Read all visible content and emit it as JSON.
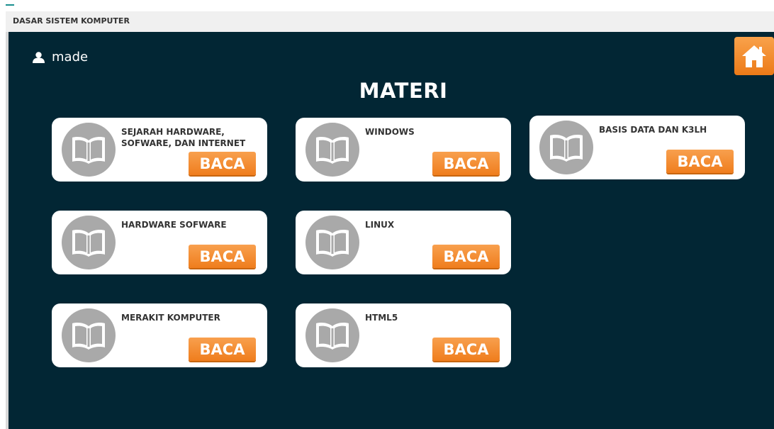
{
  "window": {
    "title": "DASAR SISTEM KOMPUTER"
  },
  "user": {
    "name": "made",
    "icon": "user-icon"
  },
  "home": {
    "icon": "home-icon"
  },
  "page": {
    "title": "MATERI"
  },
  "materials": [
    {
      "title": "SEJARAH HARDWARE, SOFWARE, DAN INTERNET",
      "button": "BACA"
    },
    {
      "title": "WINDOWS",
      "button": "BACA"
    },
    {
      "title": "BASIS DATA DAN K3LH",
      "button": "BACA"
    },
    {
      "title": "HARDWARE SOFWARE",
      "button": "BACA"
    },
    {
      "title": "LINUX",
      "button": "BACA"
    },
    {
      "title": "MERAKIT KOMPUTER",
      "button": "BACA"
    },
    {
      "title": "HTML5",
      "button": "BACA"
    }
  ],
  "colors": {
    "background": "#022634",
    "accent": "#f39237",
    "card": "#ffffff",
    "icon_circle": "#a9a9a9"
  }
}
